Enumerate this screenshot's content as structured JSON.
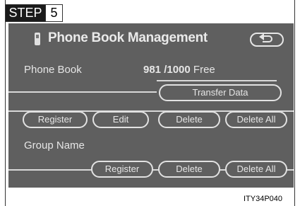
{
  "step": {
    "label": "STEP",
    "number": "5"
  },
  "screen": {
    "title": "Phone Book Management",
    "phone_book_label": "Phone Book",
    "phone_book_count": "981 /1000",
    "phone_book_free": "Free",
    "transfer_button": "Transfer Data",
    "phone_book_buttons": [
      "Register",
      "Edit",
      "Delete",
      "Delete All"
    ],
    "group_name_label": "Group Name",
    "group_buttons": [
      "Register",
      "Delete",
      "Delete All"
    ],
    "back_icon": "return-arrow-icon",
    "phone_icon": "phone-icon"
  },
  "caption": "ITY34P040"
}
